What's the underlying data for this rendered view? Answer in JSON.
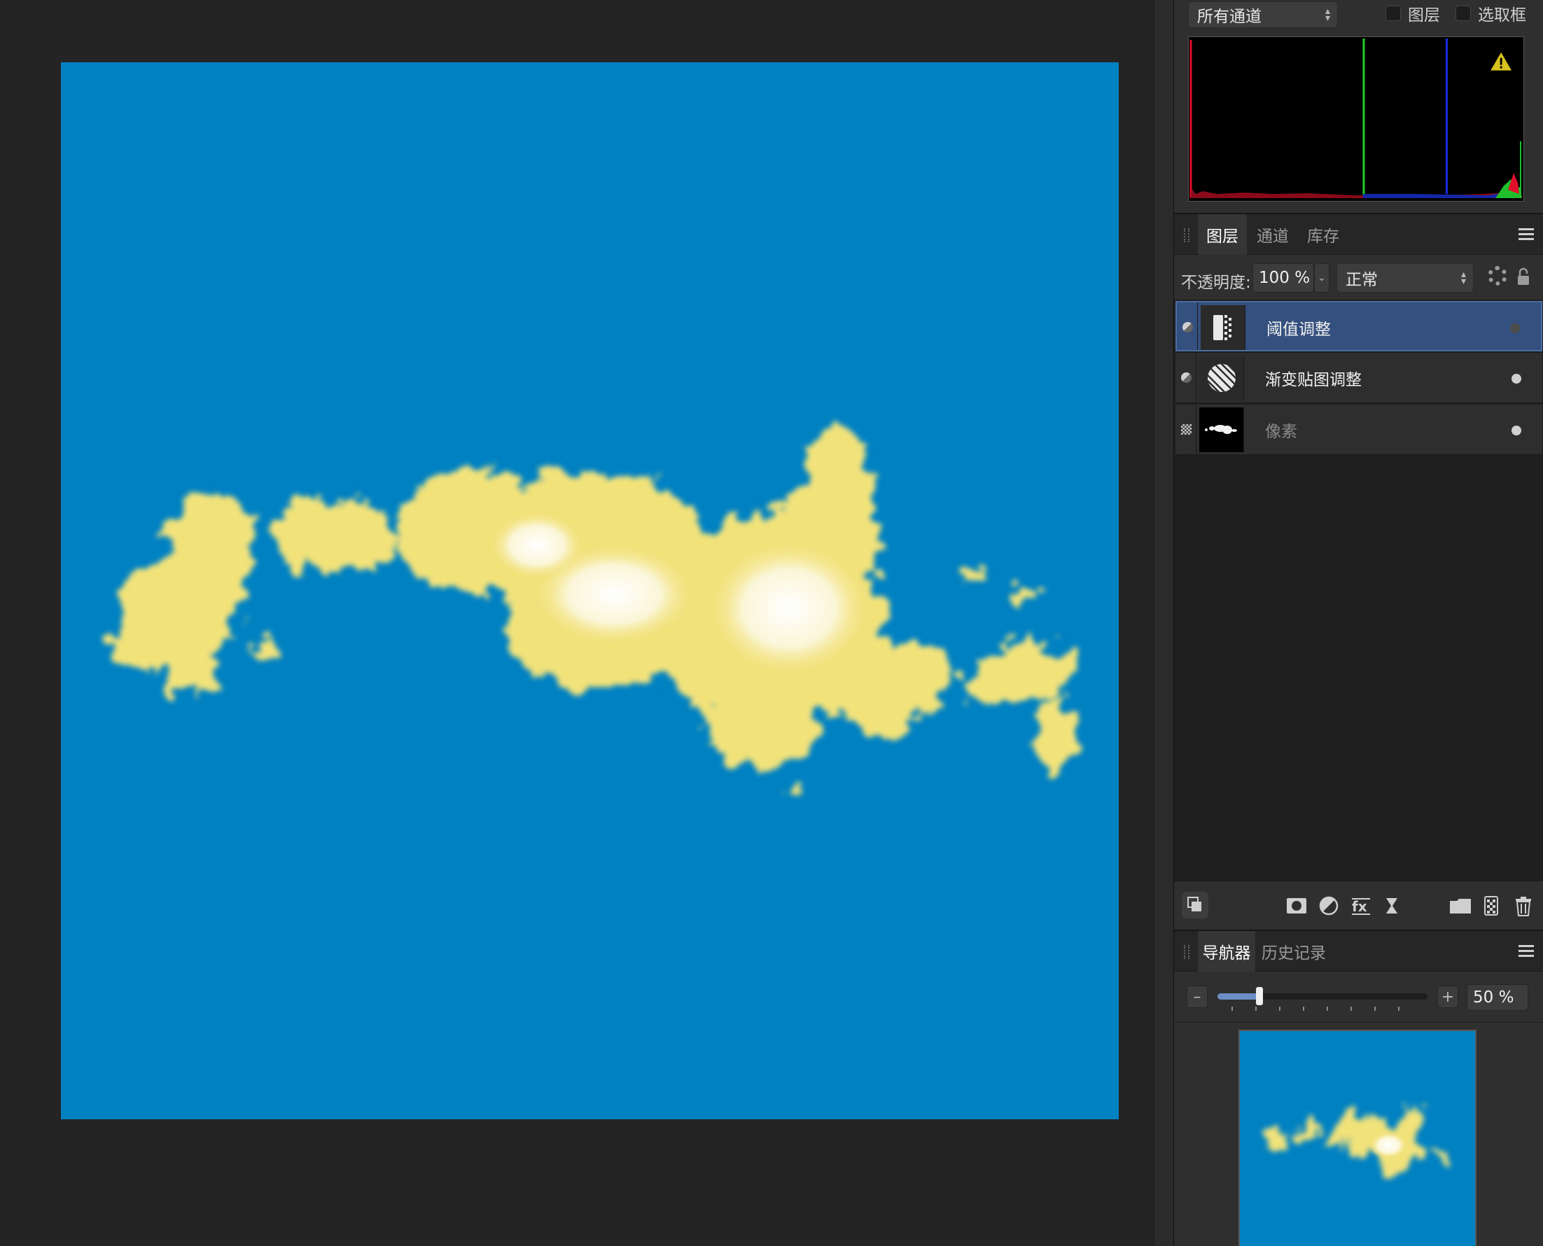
{
  "histogram": {
    "channel_select": "所有通道",
    "layer_checkbox": "图层",
    "marquee_checkbox": "选取框"
  },
  "layers_panel": {
    "tabs": [
      "图层",
      "通道",
      "库存"
    ],
    "opacity_label": "不透明度:",
    "opacity_value": "100 %",
    "blend_mode": "正常",
    "layers": [
      {
        "name": "阈值调整",
        "selected": true,
        "icon": "threshold-adjustment-icon"
      },
      {
        "name": "渐变贴图调整",
        "selected": false,
        "icon": "gradient-map-adjustment-icon"
      },
      {
        "name": "像素",
        "selected": false,
        "icon": "pixel-layer-thumbnail"
      }
    ]
  },
  "navigator_panel": {
    "tabs": [
      "导航器",
      "历史记录"
    ],
    "zoom_value": "50 %",
    "zoom_level": 0.2
  },
  "colors": {
    "canvas_blue": "#0081c2",
    "cloud_yellow": "#f2e27a",
    "selection_blue": "#34507e"
  }
}
